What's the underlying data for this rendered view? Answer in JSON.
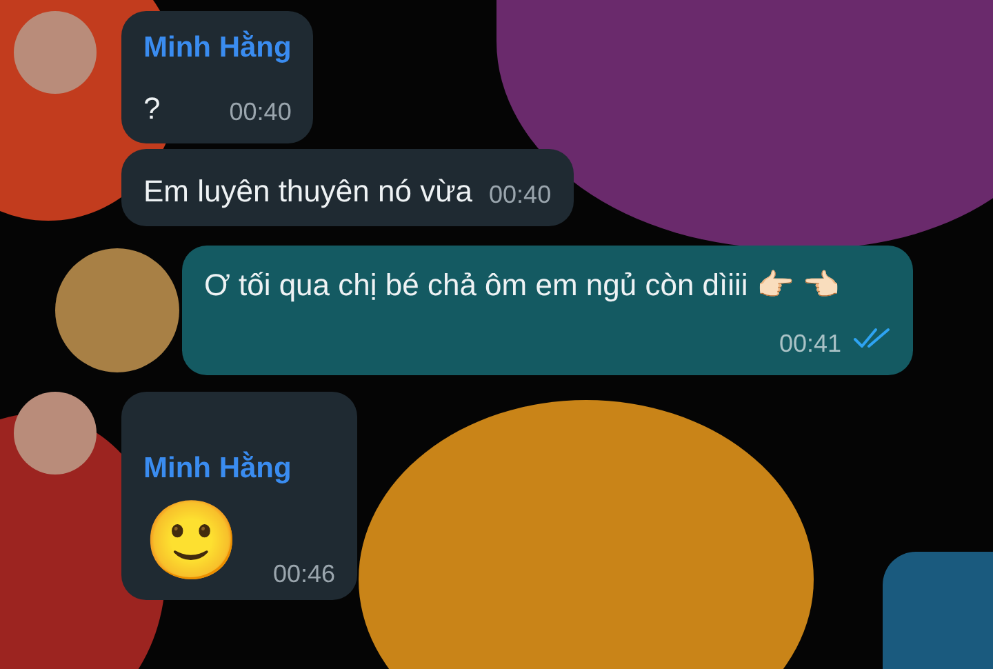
{
  "groups": [
    {
      "kind": "incoming",
      "sender": "Minh Hằng",
      "messages": [
        {
          "kind": "text",
          "text": "?",
          "time": "00:40"
        },
        {
          "kind": "text",
          "text": "Em luyên thuyên nó vừa",
          "time": "00:40"
        }
      ]
    },
    {
      "kind": "outgoing",
      "messages": [
        {
          "kind": "text",
          "text": "Ơ tối qua chị bé chả ôm em ngủ còn dìiii 👉🏻 👈🏻",
          "time": "00:41",
          "read": true
        }
      ]
    },
    {
      "kind": "incoming",
      "sender": "Minh Hằng",
      "messages": [
        {
          "kind": "emoji",
          "text": "🙂",
          "time": "00:46"
        }
      ]
    }
  ]
}
